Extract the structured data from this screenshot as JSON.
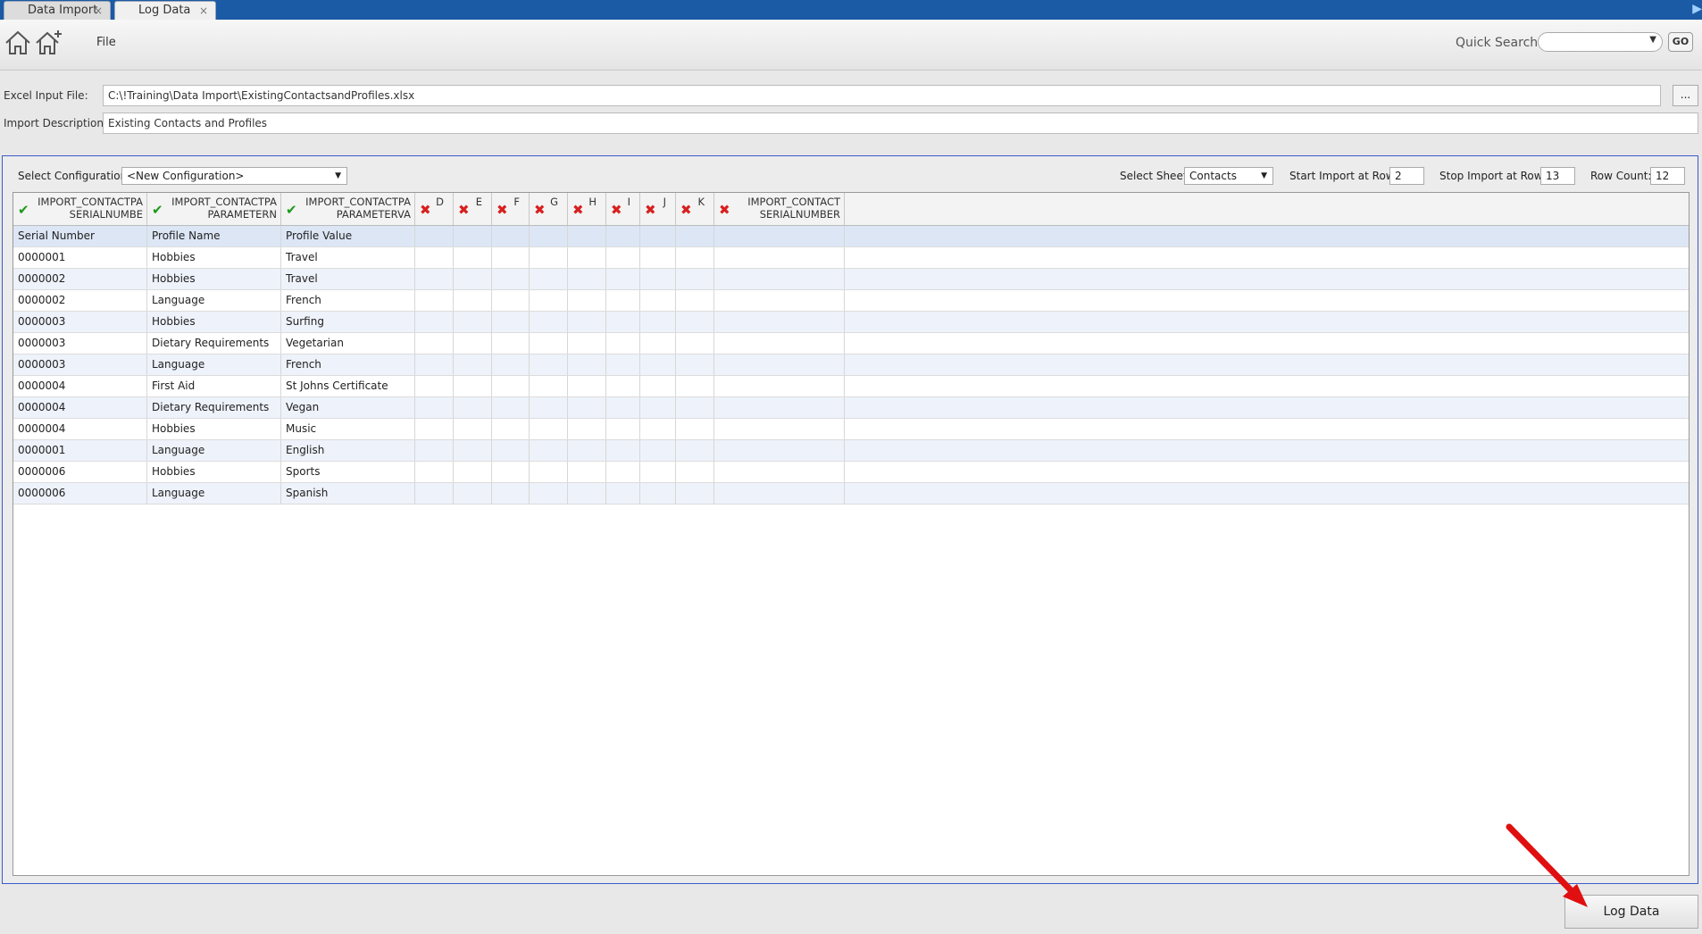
{
  "tabs": [
    {
      "label": "Data Import",
      "close": "×"
    },
    {
      "label": "Log Data",
      "close": "×"
    }
  ],
  "toolbar": {
    "file_menu": "File",
    "quick_search_label": "Quick Search",
    "quick_search_value": "",
    "go_label": "GO"
  },
  "form": {
    "excel_input_label": "Excel Input File:",
    "excel_input_value": "C:\\!Training\\Data Import\\ExistingContactsandProfiles.xlsx",
    "browse_label": "...",
    "import_description_label": "Import Description:",
    "import_description_value": "Existing Contacts and Profiles"
  },
  "config": {
    "select_configuration_label": "Select Configuration",
    "select_configuration_value": "<New Configuration>",
    "select_sheet_label": "Select Sheet",
    "select_sheet_value": "Contacts",
    "start_row_label": "Start Import at Row:",
    "start_row_value": "2",
    "stop_row_label": "Stop Import at Row:",
    "stop_row_value": "13",
    "row_count_label": "Row Count:",
    "row_count_value": "12"
  },
  "grid": {
    "columns": [
      {
        "status": "ok",
        "line1": "IMPORT_CONTACTPA",
        "line2": "SERIALNUMBE"
      },
      {
        "status": "ok",
        "line1": "IMPORT_CONTACTPA",
        "line2": "PARAMETERN"
      },
      {
        "status": "ok",
        "line1": "IMPORT_CONTACTPA",
        "line2": "PARAMETERVA"
      },
      {
        "status": "bad",
        "line1": "D",
        "line2": ""
      },
      {
        "status": "bad",
        "line1": "E",
        "line2": ""
      },
      {
        "status": "bad",
        "line1": "F",
        "line2": ""
      },
      {
        "status": "bad",
        "line1": "G",
        "line2": ""
      },
      {
        "status": "bad",
        "line1": "H",
        "line2": ""
      },
      {
        "status": "bad",
        "line1": "I",
        "line2": ""
      },
      {
        "status": "bad",
        "line1": "J",
        "line2": ""
      },
      {
        "status": "bad",
        "line1": "K",
        "line2": ""
      },
      {
        "status": "bad",
        "line1": "IMPORT_CONTACT",
        "line2": "SERIALNUMBER"
      }
    ],
    "rows": [
      [
        "Serial Number",
        "Profile Name",
        "Profile Value"
      ],
      [
        "0000001",
        "Hobbies",
        "Travel"
      ],
      [
        "0000002",
        "Hobbies",
        "Travel"
      ],
      [
        "0000002",
        "Language",
        "French"
      ],
      [
        "0000003",
        "Hobbies",
        "Surfing"
      ],
      [
        "0000003",
        "Dietary Requirements",
        "Vegetarian"
      ],
      [
        "0000003",
        "Language",
        "French"
      ],
      [
        "0000004",
        "First Aid",
        "St Johns Certificate"
      ],
      [
        "0000004",
        "Dietary Requirements",
        "Vegan"
      ],
      [
        "0000004",
        "Hobbies",
        "Music"
      ],
      [
        "0000001",
        "Language",
        "English"
      ],
      [
        "0000006",
        "Hobbies",
        "Sports"
      ],
      [
        "0000006",
        "Language",
        "Spanish"
      ]
    ]
  },
  "log_button": "Log Data",
  "colors": {
    "title_bar": "#1b5aa5",
    "panel_border": "#3b5bcc",
    "ok_icon": "#1a9a1a",
    "bad_icon": "#d81f1f",
    "annotation_arrow": "#e01010"
  }
}
